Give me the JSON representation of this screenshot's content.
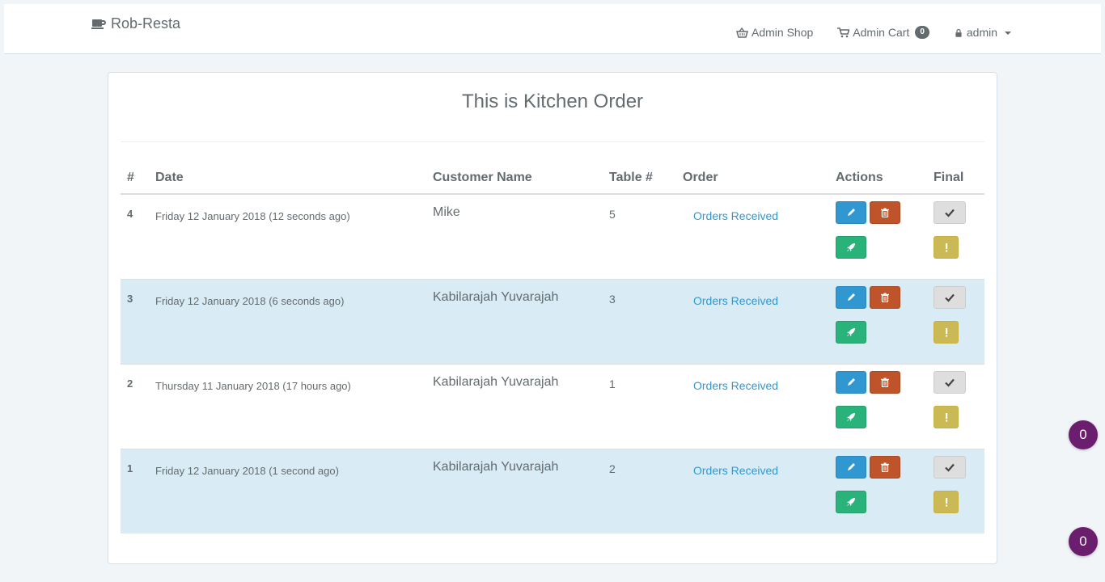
{
  "navbar": {
    "brand": "Rob-Resta",
    "links": {
      "admin_shop": "Admin Shop",
      "admin_cart": "Admin Cart",
      "cart_count": "0",
      "user": "admin"
    }
  },
  "panel": {
    "title": "This is Kitchen Order"
  },
  "table": {
    "headers": {
      "num": "#",
      "date": "Date",
      "customer": "Customer Name",
      "table": "Table #",
      "order": "Order",
      "actions": "Actions",
      "final": "Final"
    },
    "rows": [
      {
        "num": "4",
        "date": "Friday 12 January 2018 (12 seconds ago)",
        "customer": "Mike",
        "table": "5",
        "order": "Orders Received"
      },
      {
        "num": "3",
        "date": "Friday 12 January 2018 (6 seconds ago)",
        "customer": "Kabilarajah Yuvarajah",
        "table": "3",
        "order": "Orders Received"
      },
      {
        "num": "2",
        "date": "Thursday 11 January 2018 (17 hours ago)",
        "customer": "Kabilarajah Yuvarajah",
        "table": "1",
        "order": "Orders Received"
      },
      {
        "num": "1",
        "date": "Friday 12 January 2018 (1 second ago)",
        "customer": "Kabilarajah Yuvarajah",
        "table": "2",
        "order": "Orders Received"
      }
    ]
  },
  "bubbles": {
    "first": "0",
    "second": "0"
  },
  "colors": {
    "primary": "#3097d1",
    "danger": "#bf5329",
    "success": "#2ab27b",
    "warning": "#cbb956",
    "bubble": "#6b1d6e",
    "stripe": "#d9ecf5"
  },
  "icons": [
    "coffee-icon",
    "basket-icon",
    "cart-icon",
    "lock-icon",
    "pencil-icon",
    "trash-icon",
    "rocket-icon",
    "check-icon",
    "exclamation-icon"
  ]
}
